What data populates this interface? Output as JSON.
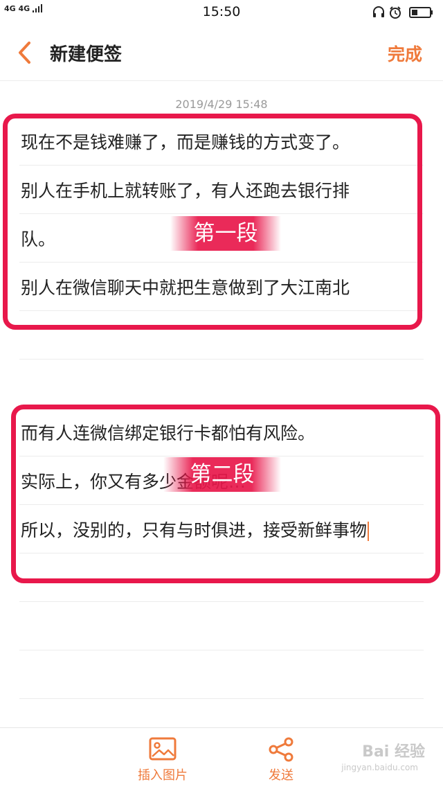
{
  "status_bar": {
    "network": "4G 4G",
    "time": "15:50"
  },
  "header": {
    "title": "新建便签",
    "done_label": "完成"
  },
  "note": {
    "date": "2019/4/29 15:48",
    "section1": {
      "tag": "第一段",
      "lines": [
        "现在不是钱难赚了，而是赚钱的方式变了。",
        "别人在手机上就转账了，有人还跑去银行排",
        "队。",
        "别人在微信聊天中就把生意做到了大江南北"
      ]
    },
    "section2": {
      "tag": "第二段",
      "lines": [
        "而有人连微信绑定银行卡都怕有风险。",
        "实际上，你又有多少金额呢…",
        "所以，没别的，只有与时俱进，接受新鲜事物"
      ]
    }
  },
  "bottom_bar": {
    "insert_image_label": "插入图片",
    "send_label": "发送"
  },
  "watermark": {
    "brand": "Bai 经验",
    "url": "jingyan.baidu.com"
  },
  "colors": {
    "accent": "#ef7a3b",
    "highlight": "#e8184b"
  }
}
